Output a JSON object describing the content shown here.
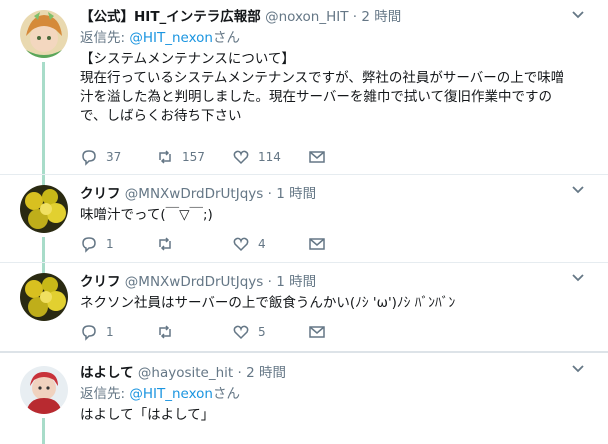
{
  "tweets": [
    {
      "name": "【公式】HIT_インテラ広報部",
      "handle": "@noxon_HIT",
      "separator": "·",
      "time": "2 時間",
      "reply_prefix": "返信先: ",
      "reply_handle": "@HIT_nexon",
      "reply_suffix": "さん",
      "text": "【システムメンテナンスについて】\n現在行っているシステムメンテナンスですが、弊社の社員がサーバーの上で味噌\n汁を溢した為と判明しました。現在サーバーを雑巾で拭いて復旧作業中ですの\nで、しばらくお待ち下さい",
      "reply_count": "37",
      "retweet_count": "157",
      "like_count": "114"
    },
    {
      "name": "クリフ",
      "handle": "@MNXwDrdDrUtJqys",
      "separator": "·",
      "time": "1 時間",
      "text": "味噌汁でって(￣▽￣;)",
      "reply_count": "1",
      "retweet_count": "",
      "like_count": "4"
    },
    {
      "name": "クリフ",
      "handle": "@MNXwDrdDrUtJqys",
      "separator": "·",
      "time": "1 時間",
      "text": "ネクソン社員はサーバーの上で飯食うんかい(ﾉｼ 'ω')ﾉｼ ﾊﾞﾝﾊﾞﾝ",
      "reply_count": "1",
      "retweet_count": "",
      "like_count": "5"
    },
    {
      "name": "はよして",
      "handle": "@hayosite_hit",
      "separator": "·",
      "time": "2 時間",
      "reply_prefix": "返信先: ",
      "reply_handle": "@HIT_nexon",
      "reply_suffix": "さん",
      "text": "はよして「はよして」"
    }
  ],
  "colors": {
    "link": "#1b95e0",
    "muted": "#657786",
    "thread_line": "#a8dcc9"
  },
  "icons": [
    "reply-icon",
    "retweet-icon",
    "like-icon",
    "dm-icon",
    "chevron-down-icon"
  ]
}
